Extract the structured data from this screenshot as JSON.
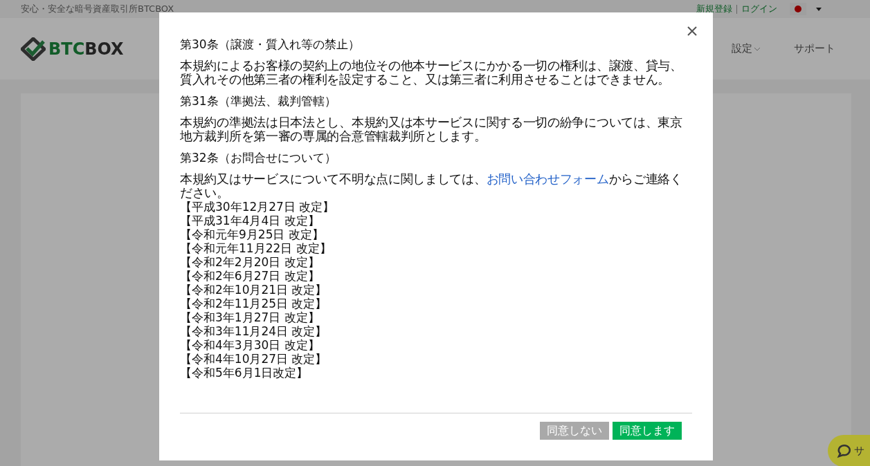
{
  "top_bar": {
    "tagline": "安心・安全な暗号資産取引所BTCBOX",
    "register_link": "新規登録",
    "login_link": "ログイン"
  },
  "header": {
    "logo": {
      "part1": "BTC",
      "part2": "BOX"
    },
    "nav": [
      {
        "label": "設定",
        "dropdown": true
      },
      {
        "label": "サポート",
        "dropdown": false
      }
    ]
  },
  "modal": {
    "sections": [
      {
        "heading": "第30条（譲渡・質入れ等の禁止）",
        "body": "本規約によるお客様の契約上の地位その他本サービスにかかる一切の権利は、譲渡、貸与、質入れその他第三者の権利を設定すること、又は第三者に利用させることはできません。"
      },
      {
        "heading": "第31条（準拠法、裁判管轄）",
        "body": "本規約の準拠法は日本法とし、本規約又は本サービスに関する一切の紛争については、東京地方裁判所を第一審の専属的合意管轄裁判所とします。"
      },
      {
        "heading": "第32条（お問合せについて）",
        "body": "本規約又はサービスについて不明な点に関しましては、",
        "link": "お問い合わせフォーム",
        "body_after": "からご連絡ください。"
      }
    ],
    "revisions": [
      "【平成30年12月27日 改定】",
      "【平成31年4月4日 改定】",
      "【令和元年9月25日 改定】",
      "【令和元年11月22日 改定】",
      "【令和2年2月20日 改定】",
      "【令和2年6月27日 改定】",
      "【令和2年10月21日 改定】",
      "【令和2年11月25日 改定】",
      "【令和3年1月27日 改定】",
      "【令和3年11月24日 改定】",
      "【令和4年3月30日 改定】",
      "【令和4年10月27日 改定】",
      "【令和5年6月1日改定】"
    ],
    "buttons": [
      {
        "label": "同意しない",
        "kind": "decline"
      },
      {
        "label": "同意します",
        "kind": "accept"
      }
    ]
  },
  "chat_button": {
    "label": "サ"
  }
}
